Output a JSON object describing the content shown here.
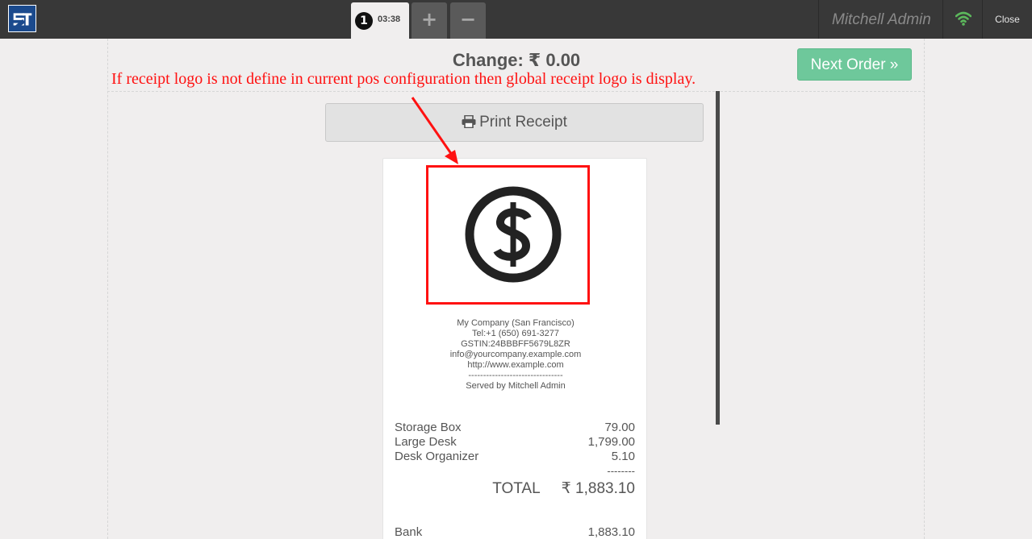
{
  "topbar": {
    "logo_icon": "company-logo-icon",
    "order_number": "1",
    "order_time": "03:38",
    "add_order_label": "+",
    "remove_order_label": "−",
    "username": "Mitchell Admin",
    "wifi_icon": "wifi-icon",
    "wifi_color": "#5cb85c",
    "close_label": "Close"
  },
  "screen": {
    "change_text": "Change: ₹ 0.00",
    "next_order_label": "Next Order »",
    "next_order_color": "#6ec89b",
    "print_label": "Print Receipt",
    "print_icon": "print-icon"
  },
  "annotation": {
    "text": "If receipt logo is not define in current pos configuration then global receipt logo is display.",
    "color": "#ff1111"
  },
  "receipt": {
    "logo_icon": "dollar-circle-icon",
    "company_lines": [
      "My Company (San Francisco)",
      "Tel:+1 (650) 691-3277",
      "GSTIN:24BBBFF5679L8ZR",
      "info@yourcompany.example.com",
      "http://www.example.com",
      "--------------------------------",
      "Served by Mitchell Admin"
    ],
    "lines": [
      {
        "name": "Storage Box",
        "amount": "79.00"
      },
      {
        "name": "Large Desk",
        "amount": "1,799.00"
      },
      {
        "name": "Desk Organizer",
        "amount": "5.10"
      }
    ],
    "separator": "--------",
    "total_label": "TOTAL",
    "total_value": "₹ 1,883.10",
    "payment": {
      "method": "Bank",
      "amount": "1,883.10"
    }
  }
}
